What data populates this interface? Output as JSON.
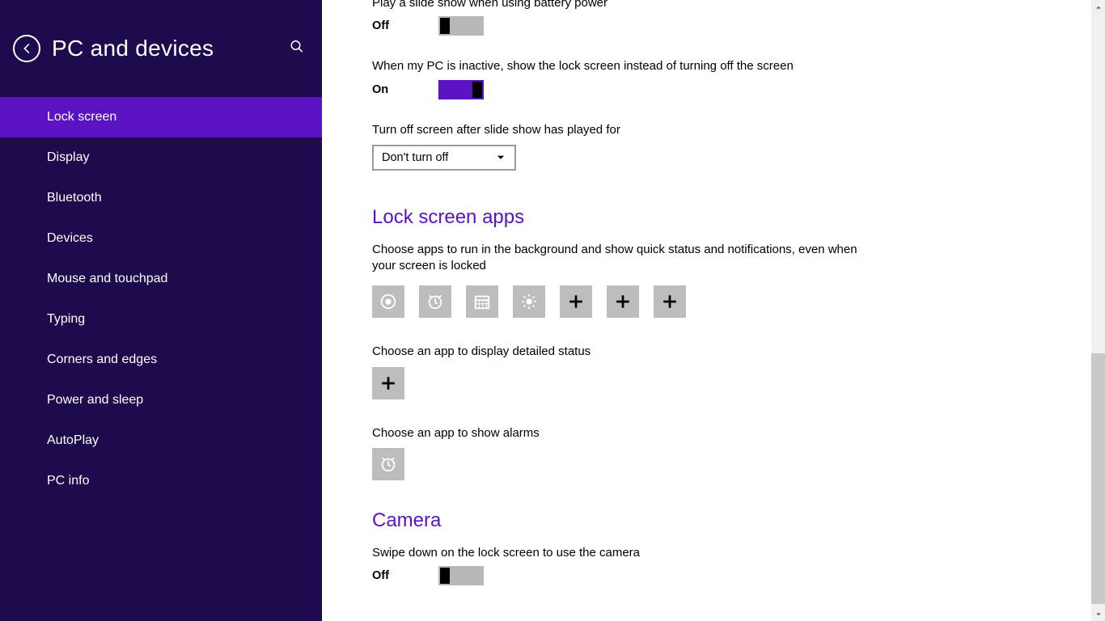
{
  "header": {
    "title": "PC and devices"
  },
  "sidebar": {
    "items": [
      {
        "label": "Lock screen",
        "active": true
      },
      {
        "label": "Display",
        "active": false
      },
      {
        "label": "Bluetooth",
        "active": false
      },
      {
        "label": "Devices",
        "active": false
      },
      {
        "label": "Mouse and touchpad",
        "active": false
      },
      {
        "label": "Typing",
        "active": false
      },
      {
        "label": "Corners and edges",
        "active": false
      },
      {
        "label": "Power and sleep",
        "active": false
      },
      {
        "label": "AutoPlay",
        "active": false
      },
      {
        "label": "PC info",
        "active": false
      }
    ]
  },
  "settings": {
    "battery_slideshow": {
      "label": "Play a slide show when using battery power",
      "state": "Off"
    },
    "inactive_lockscreen": {
      "label": "When my PC is inactive, show the lock screen instead of turning off the screen",
      "state": "On"
    },
    "turn_off_after": {
      "label": "Turn off screen after slide show has played for",
      "value": "Don't turn off"
    }
  },
  "lockscreen_apps": {
    "heading": "Lock screen apps",
    "quick_status_desc": "Choose apps to run in the background and show quick status and notifications, even when your screen is locked",
    "detailed_status_label": "Choose an app to display detailed status",
    "alarms_label": "Choose an app to show alarms"
  },
  "camera": {
    "heading": "Camera",
    "swipe": {
      "label": "Swipe down on the lock screen to use the camera",
      "state": "Off"
    }
  },
  "icons": {
    "quick_slots": [
      "record",
      "alarm",
      "calendar",
      "weather",
      "plus",
      "plus",
      "plus"
    ]
  }
}
